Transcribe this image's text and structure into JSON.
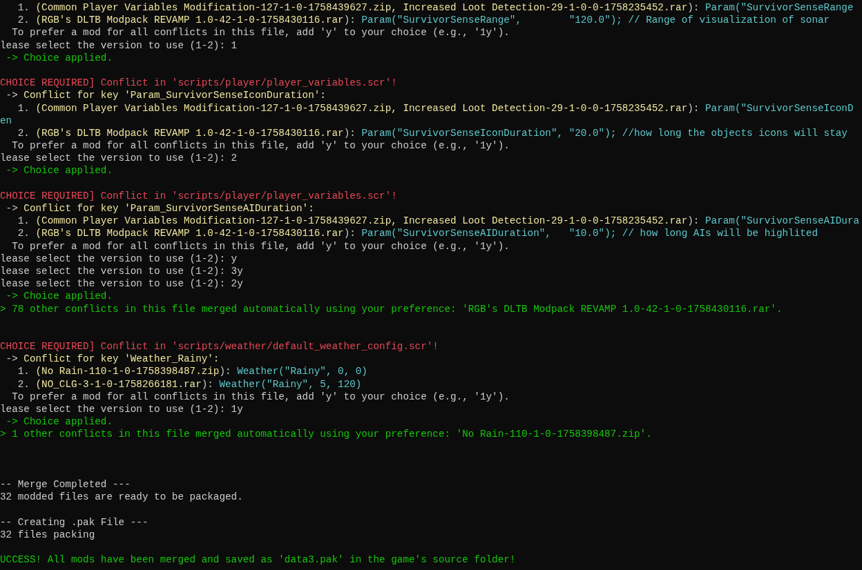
{
  "terminal": {
    "lines": [
      {
        "kind": "text",
        "segments": [
          {
            "kind": "plain",
            "text": "   1. "
          },
          {
            "kind": "file",
            "text": "(Common Player Variables Modification-127-1-0-1758439627.zip, Increased Loot Detection-29-1-0-0-1758235452.rar"
          },
          {
            "kind": "plain",
            "text": "): "
          },
          {
            "kind": "code",
            "text": "Param(\"SurvivorSenseRange"
          }
        ]
      },
      {
        "kind": "text",
        "segments": [
          {
            "kind": "plain",
            "text": "   2. "
          },
          {
            "kind": "file",
            "text": "(RGB's DLTB Modpack REVAMP 1.0-42-1-0-1758430116.rar"
          },
          {
            "kind": "plain",
            "text": "): "
          },
          {
            "kind": "code",
            "text": "Param(\"SurvivorSenseRange\",        \"120.0\"); // Range of visualization of sonar"
          }
        ]
      },
      {
        "kind": "text",
        "segments": [
          {
            "kind": "plain",
            "text": "  To prefer a mod for all conflicts in this file, add 'y' to your choice (e.g., '1y')."
          }
        ]
      },
      {
        "kind": "text",
        "segments": [
          {
            "kind": "plain",
            "text": "lease select the version to use (1-2): 1"
          }
        ]
      },
      {
        "kind": "text",
        "segments": [
          {
            "kind": "success",
            "text": " -> Choice applied."
          }
        ]
      },
      {
        "kind": "blank"
      },
      {
        "kind": "text",
        "segments": [
          {
            "kind": "error",
            "text": "CHOICE REQUIRED] Conflict in 'scripts/player/player_variables.scr'!"
          }
        ]
      },
      {
        "kind": "text",
        "segments": [
          {
            "kind": "plain",
            "text": " -> "
          },
          {
            "kind": "file",
            "text": "Conflict for key 'Param_SurvivorSenseIconDuration':"
          }
        ]
      },
      {
        "kind": "text",
        "segments": [
          {
            "kind": "plain",
            "text": "   1. "
          },
          {
            "kind": "file",
            "text": "(Common Player Variables Modification-127-1-0-1758439627.zip, Increased Loot Detection-29-1-0-0-1758235452.rar"
          },
          {
            "kind": "plain",
            "text": "): "
          },
          {
            "kind": "code",
            "text": "Param(\"SurvivorSenseIconD"
          }
        ]
      },
      {
        "kind": "text",
        "segments": [
          {
            "kind": "code",
            "text": "en"
          }
        ]
      },
      {
        "kind": "text",
        "segments": [
          {
            "kind": "plain",
            "text": "   2. "
          },
          {
            "kind": "file",
            "text": "(RGB's DLTB Modpack REVAMP 1.0-42-1-0-1758430116.rar"
          },
          {
            "kind": "plain",
            "text": "): "
          },
          {
            "kind": "code",
            "text": "Param(\"SurvivorSenseIconDuration\", \"20.0\"); //how long the objects icons will stay"
          }
        ]
      },
      {
        "kind": "text",
        "segments": [
          {
            "kind": "plain",
            "text": "  To prefer a mod for all conflicts in this file, add 'y' to your choice (e.g., '1y')."
          }
        ]
      },
      {
        "kind": "text",
        "segments": [
          {
            "kind": "plain",
            "text": "lease select the version to use (1-2): 2"
          }
        ]
      },
      {
        "kind": "text",
        "segments": [
          {
            "kind": "success",
            "text": " -> Choice applied."
          }
        ]
      },
      {
        "kind": "blank"
      },
      {
        "kind": "text",
        "segments": [
          {
            "kind": "error",
            "text": "CHOICE REQUIRED] Conflict in 'scripts/player/player_variables.scr'!"
          }
        ]
      },
      {
        "kind": "text",
        "segments": [
          {
            "kind": "plain",
            "text": " -> "
          },
          {
            "kind": "file",
            "text": "Conflict for key 'Param_SurvivorSenseAIDuration':"
          }
        ]
      },
      {
        "kind": "text",
        "segments": [
          {
            "kind": "plain",
            "text": "   1. "
          },
          {
            "kind": "file",
            "text": "(Common Player Variables Modification-127-1-0-1758439627.zip, Increased Loot Detection-29-1-0-0-1758235452.rar"
          },
          {
            "kind": "plain",
            "text": "): "
          },
          {
            "kind": "code",
            "text": "Param(\"SurvivorSenseAIDura"
          }
        ]
      },
      {
        "kind": "text",
        "segments": [
          {
            "kind": "plain",
            "text": "   2. "
          },
          {
            "kind": "file",
            "text": "(RGB's DLTB Modpack REVAMP 1.0-42-1-0-1758430116.rar"
          },
          {
            "kind": "plain",
            "text": "): "
          },
          {
            "kind": "code",
            "text": "Param(\"SurvivorSenseAIDuration\",   \"10.0\"); // how long AIs will be highlited"
          }
        ]
      },
      {
        "kind": "text",
        "segments": [
          {
            "kind": "plain",
            "text": "  To prefer a mod for all conflicts in this file, add 'y' to your choice (e.g., '1y')."
          }
        ]
      },
      {
        "kind": "text",
        "segments": [
          {
            "kind": "plain",
            "text": "lease select the version to use (1-2): y"
          }
        ]
      },
      {
        "kind": "text",
        "segments": [
          {
            "kind": "plain",
            "text": "lease select the version to use (1-2): 3y"
          }
        ]
      },
      {
        "kind": "text",
        "segments": [
          {
            "kind": "plain",
            "text": "lease select the version to use (1-2): 2y"
          }
        ]
      },
      {
        "kind": "text",
        "segments": [
          {
            "kind": "success",
            "text": " -> Choice applied."
          }
        ]
      },
      {
        "kind": "text",
        "segments": [
          {
            "kind": "success",
            "text": "> 78 other conflicts in this file merged automatically using your preference: 'RGB's DLTB Modpack REVAMP 1.0-42-1-0-1758430116.rar'."
          }
        ]
      },
      {
        "kind": "blank"
      },
      {
        "kind": "blank"
      },
      {
        "kind": "text",
        "segments": [
          {
            "kind": "error",
            "text": "CHOICE REQUIRED] Conflict in 'scripts/weather/default_weather_config.scr'!"
          }
        ]
      },
      {
        "kind": "text",
        "segments": [
          {
            "kind": "plain",
            "text": " -> "
          },
          {
            "kind": "file",
            "text": "Conflict for key 'Weather_Rainy':"
          }
        ]
      },
      {
        "kind": "text",
        "segments": [
          {
            "kind": "plain",
            "text": "   1. "
          },
          {
            "kind": "file",
            "text": "(No Rain-110-1-0-1758398487.zip"
          },
          {
            "kind": "plain",
            "text": "): "
          },
          {
            "kind": "code",
            "text": "Weather(\"Rainy\", 0, 0)"
          }
        ]
      },
      {
        "kind": "text",
        "segments": [
          {
            "kind": "plain",
            "text": "   2. "
          },
          {
            "kind": "file",
            "text": "(NO_CLG-3-1-0-1758266181.rar"
          },
          {
            "kind": "plain",
            "text": "): "
          },
          {
            "kind": "code",
            "text": "Weather(\"Rainy\", 5, 120)"
          }
        ]
      },
      {
        "kind": "text",
        "segments": [
          {
            "kind": "plain",
            "text": "  To prefer a mod for all conflicts in this file, add 'y' to your choice (e.g., '1y')."
          }
        ]
      },
      {
        "kind": "text",
        "segments": [
          {
            "kind": "plain",
            "text": "lease select the version to use (1-2): 1y"
          }
        ]
      },
      {
        "kind": "text",
        "segments": [
          {
            "kind": "success",
            "text": " -> Choice applied."
          }
        ]
      },
      {
        "kind": "text",
        "segments": [
          {
            "kind": "success",
            "text": "> 1 other conflicts in this file merged automatically using your preference: 'No Rain-110-1-0-1758398487.zip'."
          }
        ]
      },
      {
        "kind": "blank"
      },
      {
        "kind": "blank"
      },
      {
        "kind": "blank"
      },
      {
        "kind": "text",
        "segments": [
          {
            "kind": "plain",
            "text": "-- Merge Completed ---"
          }
        ]
      },
      {
        "kind": "text",
        "segments": [
          {
            "kind": "plain",
            "text": "32 modded files are ready to be packaged."
          }
        ]
      },
      {
        "kind": "blank"
      },
      {
        "kind": "text",
        "segments": [
          {
            "kind": "plain",
            "text": "-- Creating .pak File ---"
          }
        ]
      },
      {
        "kind": "text",
        "segments": [
          {
            "kind": "plain",
            "text": "32 files packing"
          }
        ]
      },
      {
        "kind": "blank"
      },
      {
        "kind": "text",
        "segments": [
          {
            "kind": "success",
            "text": "UCCESS! All mods have been merged and saved as 'data3.pak' in the game's source folder!"
          }
        ]
      }
    ]
  }
}
